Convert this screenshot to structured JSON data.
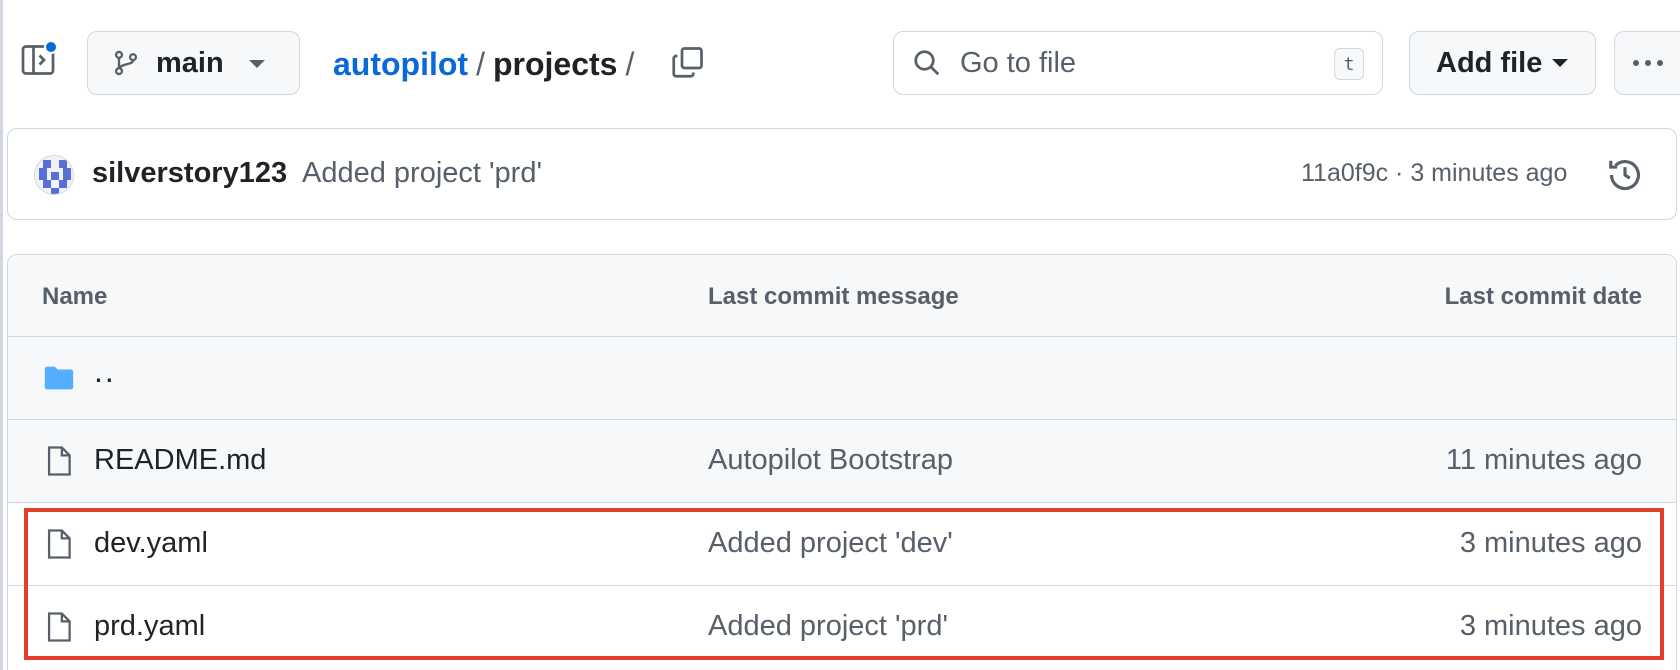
{
  "toolbar": {
    "branch": "main",
    "breadcrumb": {
      "repo": "autopilot",
      "separator": "/",
      "dir": "projects",
      "trailing": "/"
    },
    "search": {
      "placeholder": "Go to file",
      "shortcut": "t"
    },
    "add_file_label": "Add file",
    "icons": [
      "side-panel-icon",
      "git-branch-icon",
      "copy-icon",
      "search-icon",
      "kebab-menu-icon"
    ]
  },
  "commit": {
    "user": "silverstory123",
    "message": "Added project 'prd'",
    "meta": "11a0f9c · 3 minutes ago",
    "icons": [
      "avatar",
      "history-icon"
    ]
  },
  "table": {
    "headers": {
      "name": "Name",
      "message": "Last commit message",
      "date": "Last commit date"
    },
    "parent_label": "..",
    "rows": [
      {
        "name": "README.md",
        "message": "Autopilot Bootstrap",
        "date": "11 minutes ago"
      },
      {
        "name": "dev.yaml",
        "message": "Added project 'dev'",
        "date": "3 minutes ago"
      },
      {
        "name": "prd.yaml",
        "message": "Added project 'prd'",
        "date": "3 minutes ago"
      }
    ]
  },
  "colors": {
    "accent": "#0969da",
    "folder": "#54aeff",
    "border": "#d0d7de",
    "header_bg": "#f6f8fa",
    "highlight": "#e0402a"
  }
}
